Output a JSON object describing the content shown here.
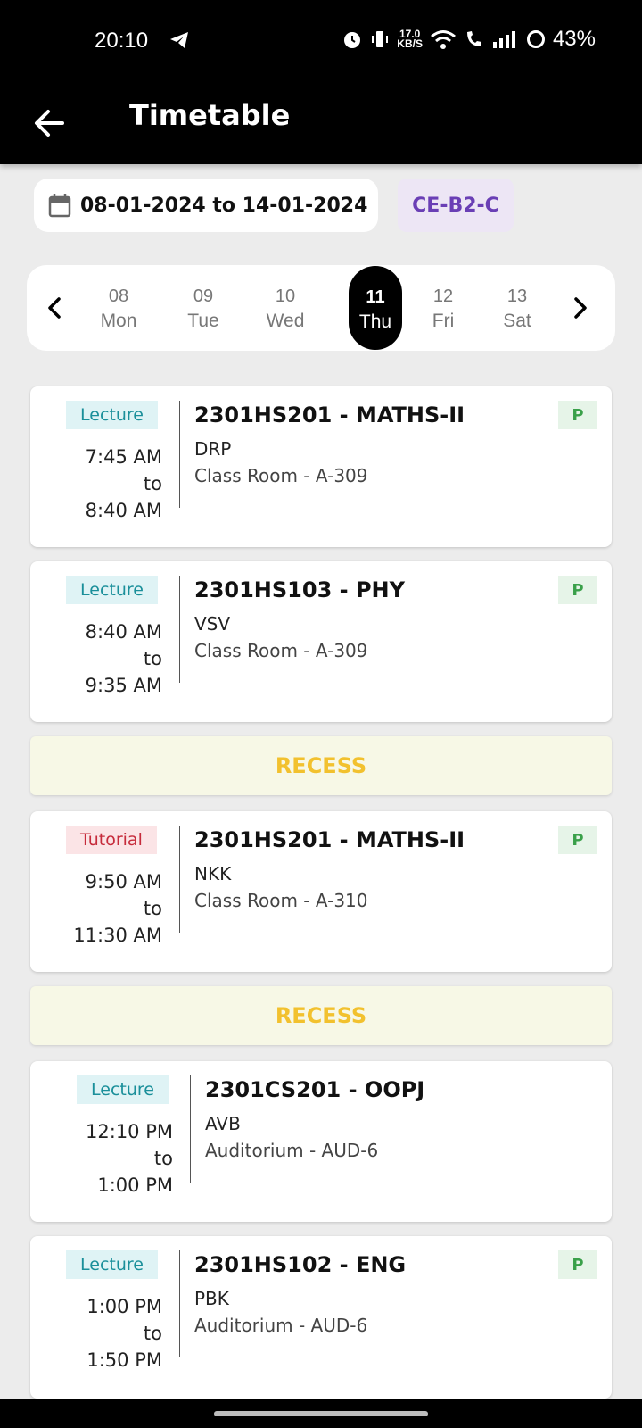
{
  "status_bar": {
    "time": "20:10",
    "net_speed_value": "17.0",
    "net_speed_unit": "KB/S",
    "battery": "43%"
  },
  "app_bar": {
    "title": "Timetable"
  },
  "filters": {
    "date_range": "08-01-2024 to 14-01-2024",
    "batch": "CE-B2-C"
  },
  "days": [
    {
      "num": "08",
      "name": "Mon"
    },
    {
      "num": "09",
      "name": "Tue"
    },
    {
      "num": "10",
      "name": "Wed"
    },
    {
      "num": "11",
      "name": "Thu",
      "selected": true
    },
    {
      "num": "12",
      "name": "Fri"
    },
    {
      "num": "13",
      "name": "Sat"
    }
  ],
  "sessions": [
    {
      "type": "Lecture",
      "start": "7:45 AM",
      "sep": "to",
      "end": "8:40 AM",
      "subject": "2301HS201 - MATHS-II",
      "faculty": "DRP",
      "room": "Class Room - A-309",
      "attendance": "P"
    },
    {
      "type": "Lecture",
      "start": "8:40 AM",
      "sep": "to",
      "end": "9:35 AM",
      "subject": "2301HS103 - PHY",
      "faculty": "VSV",
      "room": "Class Room - A-309",
      "attendance": "P"
    },
    {
      "type": "Tutorial",
      "start": "9:50 AM",
      "sep": "to",
      "end": "11:30 AM",
      "subject": "2301HS201 - MATHS-II",
      "faculty": "NKK",
      "room": "Class Room - A-310",
      "attendance": "P"
    },
    {
      "type": "Lecture",
      "start": "12:10 PM",
      "sep": "to",
      "end": "1:00 PM",
      "subject": "2301CS201 - OOPJ",
      "faculty": "AVB",
      "room": "Auditorium - AUD-6",
      "attendance": ""
    },
    {
      "type": "Lecture",
      "start": "1:00 PM",
      "sep": "to",
      "end": "1:50 PM",
      "subject": "2301HS102 - ENG",
      "faculty": "PBK",
      "room": "Auditorium - AUD-6",
      "attendance": "P"
    }
  ],
  "recess_label": "RECESS",
  "colors": {
    "lecture_tag": "#1a8f9a",
    "tutorial_tag": "#c62b3b",
    "present": "#3aa04a",
    "recess": "#f2c12e",
    "batch": "#6a3fb5"
  }
}
